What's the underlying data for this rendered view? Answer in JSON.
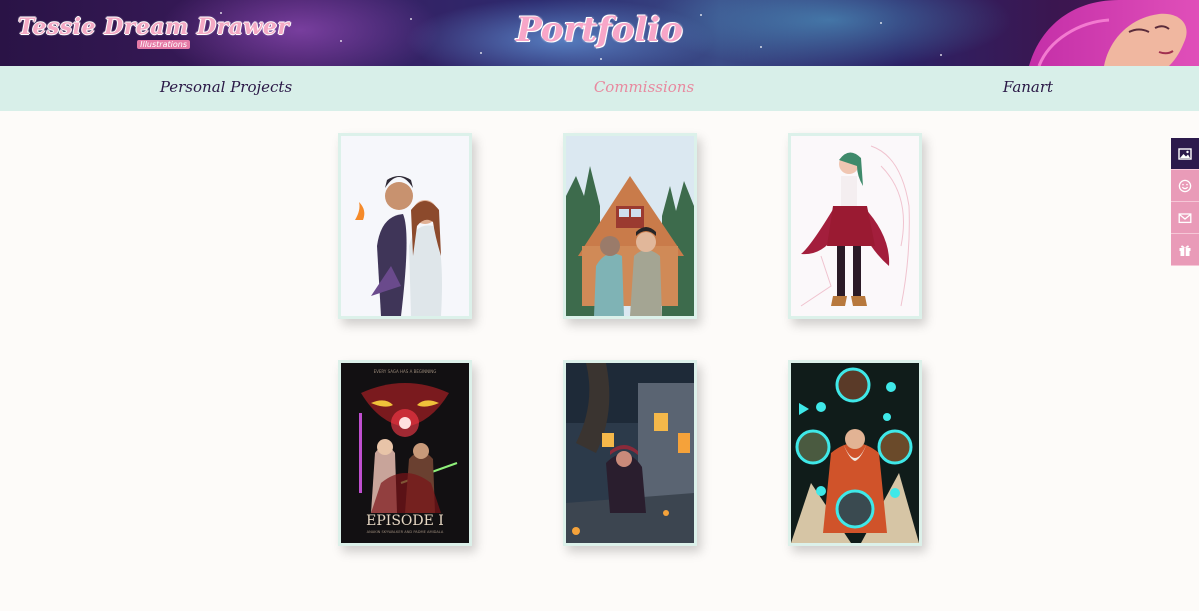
{
  "header": {
    "logo_text": "Tessie Dream Drawer",
    "logo_subtitle": "Illustrations",
    "title": "Portfolio"
  },
  "nav": {
    "items": [
      {
        "label": "Personal Projects",
        "active": false
      },
      {
        "label": "Commissions",
        "active": true
      },
      {
        "label": "Fanart",
        "active": false
      }
    ]
  },
  "gallery": {
    "items": [
      {
        "subject": "couple-fantasy-portrait"
      },
      {
        "subject": "cabin-duo-portrait"
      },
      {
        "subject": "red-caped-heroine"
      },
      {
        "subject": "episode-1-poster"
      },
      {
        "subject": "night-alley-scene"
      },
      {
        "subject": "dungeon-masters-medallions"
      }
    ],
    "poster_text": "EPISODE I",
    "poster_tagline": "EVERY SAGA HAS A BEGINNING",
    "poster_subtitle": "ANAKIN SKYWALKER AND PADME AMIDALA"
  },
  "side_menu": {
    "items": [
      {
        "icon": "image-icon",
        "active": true
      },
      {
        "icon": "smiley-icon",
        "active": false
      },
      {
        "icon": "envelope-icon",
        "active": false
      },
      {
        "icon": "gift-icon",
        "active": false
      }
    ]
  },
  "colors": {
    "accent_pink": "#e8899f",
    "nav_bg": "#d8efe9",
    "dark_purple": "#2c1a4c"
  }
}
